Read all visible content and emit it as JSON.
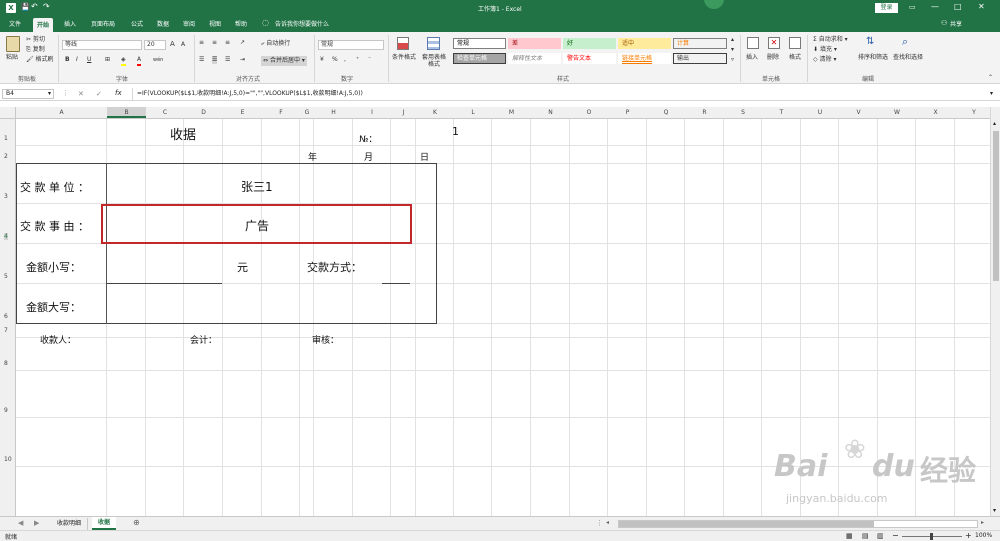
{
  "window": {
    "title": "工作簿1 - Excel",
    "login": "登录"
  },
  "qat": {
    "save": "💾",
    "undo": "↶",
    "redo": "↷"
  },
  "tabs": [
    "文件",
    "开始",
    "插入",
    "页面布局",
    "公式",
    "数据",
    "审阅",
    "视图",
    "帮助"
  ],
  "active_tab": "开始",
  "tell_me": "告诉我你想要做什么",
  "share": "共享",
  "ribbon": {
    "clipboard": {
      "paste": "粘贴",
      "cut": "剪切",
      "copy": "复制",
      "painter": "格式刷",
      "group": "剪贴板"
    },
    "font": {
      "name": "等线",
      "size": "20",
      "bold": "B",
      "italic": "I",
      "underline": "U",
      "group": "字体",
      "grow": "A",
      "shrink": "A",
      "phonetic": "wén"
    },
    "alignment": {
      "wrap": "自动换行",
      "merge": "合并后居中",
      "group": "对齐方式"
    },
    "number": {
      "format": "常规",
      "group": "数字",
      "percent": "%",
      "comma": ","
    },
    "styles": {
      "conditional": "条件格式",
      "table": "套用表格格式",
      "group": "样式",
      "items": [
        {
          "label": "常规",
          "bg": "#ffffff",
          "fg": "#000000",
          "border": "#7f7f7f"
        },
        {
          "label": "差",
          "bg": "#ffc7ce",
          "fg": "#9c0006",
          "border": "#ffc7ce"
        },
        {
          "label": "好",
          "bg": "#c6efce",
          "fg": "#006100",
          "border": "#c6efce"
        },
        {
          "label": "适中",
          "bg": "#ffeb9c",
          "fg": "#9c5700",
          "border": "#ffeb9c"
        },
        {
          "label": "计算",
          "bg": "#f2f2f2",
          "fg": "#fa7d00",
          "border": "#7f7f7f"
        },
        {
          "label": "检查单元格",
          "bg": "#a5a5a5",
          "fg": "#ffffff",
          "border": "#3f3f3f"
        },
        {
          "label": "解释性文本",
          "bg": "#ffffff",
          "fg": "#7f7f7f",
          "border": "#ffffff"
        },
        {
          "label": "警告文本",
          "bg": "#ffffff",
          "fg": "#ff0000",
          "border": "#ffffff"
        },
        {
          "label": "链接单元格",
          "bg": "#ffffff",
          "fg": "#fa7d00",
          "border": "#ffffff"
        },
        {
          "label": "输出",
          "bg": "#f2f2f2",
          "fg": "#3f3f3f",
          "border": "#3f3f3f"
        }
      ]
    },
    "cells": {
      "insert": "插入",
      "delete": "删除",
      "format": "格式",
      "group": "单元格"
    },
    "editing": {
      "autosum": "自动求和",
      "fill": "填充",
      "clear": "清除",
      "sort": "排序和筛选",
      "find": "查找和选择",
      "group": "编辑"
    }
  },
  "formula": {
    "namebox": "B4",
    "cancel": "✕",
    "enter": "✓",
    "fx": "fx",
    "content": "=IF(VLOOKUP($L$1,收款明细!A:J,5,0)=\"\",\"\",VLOOKUP($L$1,收款明细!A:J,5,0))"
  },
  "columns": [
    "A",
    "B",
    "C",
    "D",
    "E",
    "F",
    "G",
    "H",
    "I",
    "J",
    "K",
    "L",
    "M",
    "N",
    "O",
    "P",
    "Q",
    "R",
    "S",
    "T",
    "U",
    "V",
    "W",
    "X",
    "Y"
  ],
  "rows": [
    "1",
    "2",
    "3",
    "4",
    "5",
    "6",
    "7",
    "8",
    "9",
    "10"
  ],
  "cells": {
    "title": "收据",
    "no_label": "№：",
    "no_value": "1",
    "year": "年",
    "month": "月",
    "day": "日",
    "payer_label": "交 款 单 位 ：",
    "payer_value": "张三1",
    "reason_label": "交 款 事 由 ：",
    "reason_value": "广告",
    "amount_small_label": "金额小写：",
    "yuan": "元",
    "pay_method_label": "交款方式：",
    "amount_big_label": "金额大写：",
    "receiver": "收款人：",
    "accountant": "会计：",
    "reviewer": "审核："
  },
  "sheets": [
    "收款明细",
    "收据"
  ],
  "active_sheet": "收据",
  "status": {
    "ready": "就绪",
    "zoom": "100%"
  },
  "watermark": {
    "brand": "Bai",
    "brand2": "du",
    "cn": "经验",
    "url": "jingyan.baidu.com"
  },
  "colors": {
    "excel_green": "#217346",
    "highlight": "#c0282a"
  }
}
